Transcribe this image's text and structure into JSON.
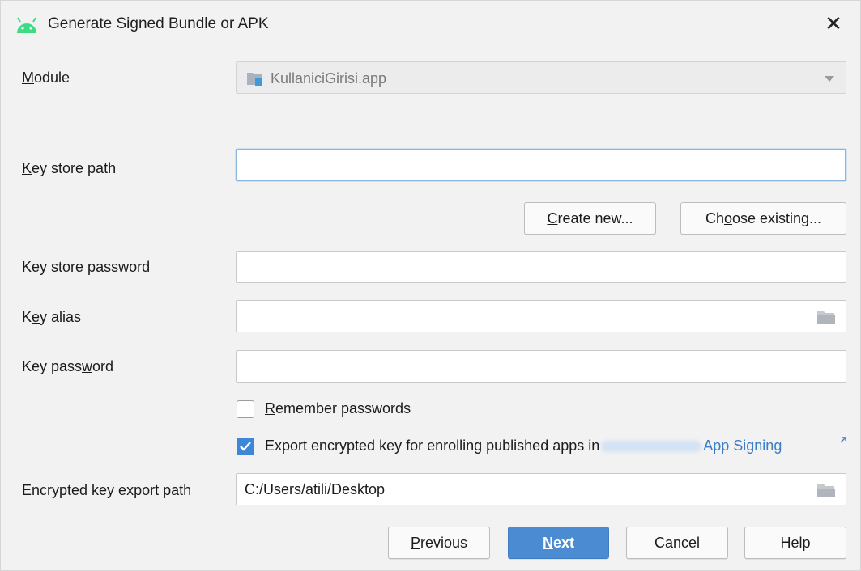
{
  "window": {
    "title": "Generate Signed Bundle or APK",
    "close_glyph": "✕",
    "app_icon": "android-icon",
    "accent_color": "#4a8bd2"
  },
  "module": {
    "label_prefix": "",
    "label_mnemonic": "M",
    "label_rest": "odule",
    "value": "KullaniciGirisi.app",
    "icon": "module-folder-icon"
  },
  "key_store_path": {
    "label_mnemonic": "K",
    "label_rest": "ey store path",
    "value": ""
  },
  "buttons_keystore": {
    "create_mnemonic": "C",
    "create_rest": "reate new...",
    "choose_prefix": "Ch",
    "choose_mnemonic": "o",
    "choose_rest": "ose existing..."
  },
  "key_store_password": {
    "label_prefix": "Key store ",
    "label_mnemonic": "p",
    "label_rest": "assword",
    "value": ""
  },
  "key_alias": {
    "label_prefix": "K",
    "label_mnemonic": "e",
    "label_rest": "y alias",
    "value": ""
  },
  "key_password": {
    "label_prefix": "Key pass",
    "label_mnemonic": "w",
    "label_rest": "ord",
    "value": ""
  },
  "remember": {
    "label_mnemonic": "R",
    "label_rest": "emember passwords",
    "checked": false
  },
  "export": {
    "label_text": "Export encrypted key for enrolling published apps in",
    "link_text": "App Signing",
    "checked": true
  },
  "encrypted_path": {
    "label": "Encrypted key export path",
    "value": "C:/Users/atili/Desktop"
  },
  "footer": {
    "previous_mnemonic": "P",
    "previous_rest": "revious",
    "next_mnemonic": "N",
    "next_rest": "ext",
    "cancel": "Cancel",
    "help": "Help"
  }
}
